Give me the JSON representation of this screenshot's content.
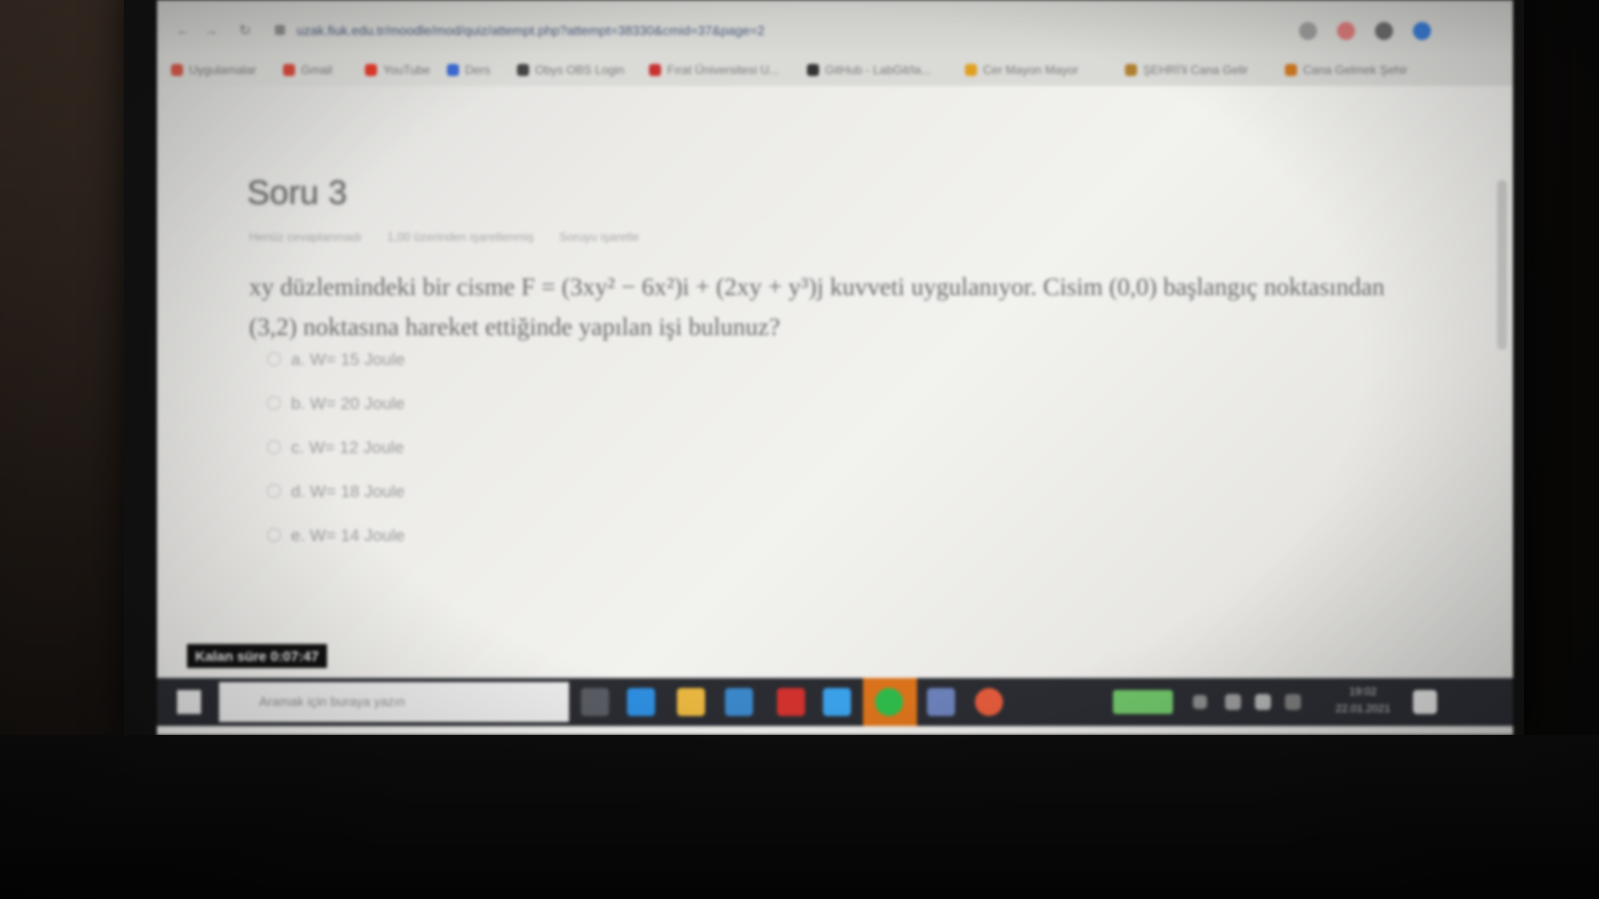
{
  "browser": {
    "address": "uzak.fiuk.edu.tr/moodle/mod/quiz/attempt.php?attempt=38330&cmid=37&page=2",
    "bookmarks": [
      {
        "label": "Uygulamalar",
        "color": "#d45a4a"
      },
      {
        "label": "Gmail",
        "color": "#d64a3a"
      },
      {
        "label": "YouTube",
        "color": "#e23a2a"
      },
      {
        "label": "Ders",
        "color": "#3a6ad4"
      },
      {
        "label": "Obys OBS Login",
        "color": "#444444"
      },
      {
        "label": "Fırat Üniversitesi U...",
        "color": "#c83232"
      },
      {
        "label": "GitHub - LabGit/la...",
        "color": "#333333"
      },
      {
        "label": "Cer Mayon Mayor",
        "color": "#e0a020"
      },
      {
        "label": "ŞEHRİ'li Cana Gelir",
        "color": "#b08030"
      },
      {
        "label": "Cana Gelmek Şehir",
        "color": "#d07a20"
      }
    ]
  },
  "question": {
    "title": "Soru 3",
    "meta": [
      "Henüz cevaplanmadı",
      "1,00 üzerinden işaretlenmiş",
      "Soruyu işaretle"
    ],
    "text": "xy düzlemindeki bir cisme F = (3xy² − 6x²)i + (2xy + y³)j kuvveti uygulanıyor. Cisim (0,0) başlangıç noktasından (3,2) noktasına hareket ettiğinde yapılan işi bulunuz?",
    "options": [
      "a. W= 15 Joule",
      "b. W= 20 Joule",
      "c. W= 12 Joule",
      "d. W= 18 Joule",
      "e. W= 14 Joule"
    ]
  },
  "timer": {
    "text": "Kalan süre 0:07:47"
  },
  "taskbar": {
    "search_placeholder": "Aramak için buraya yazın",
    "clock_time": "19:02",
    "clock_date": "22.01.2021"
  },
  "colors": {
    "taskbar_active": "#d9721b",
    "battery": "#6fc268"
  }
}
